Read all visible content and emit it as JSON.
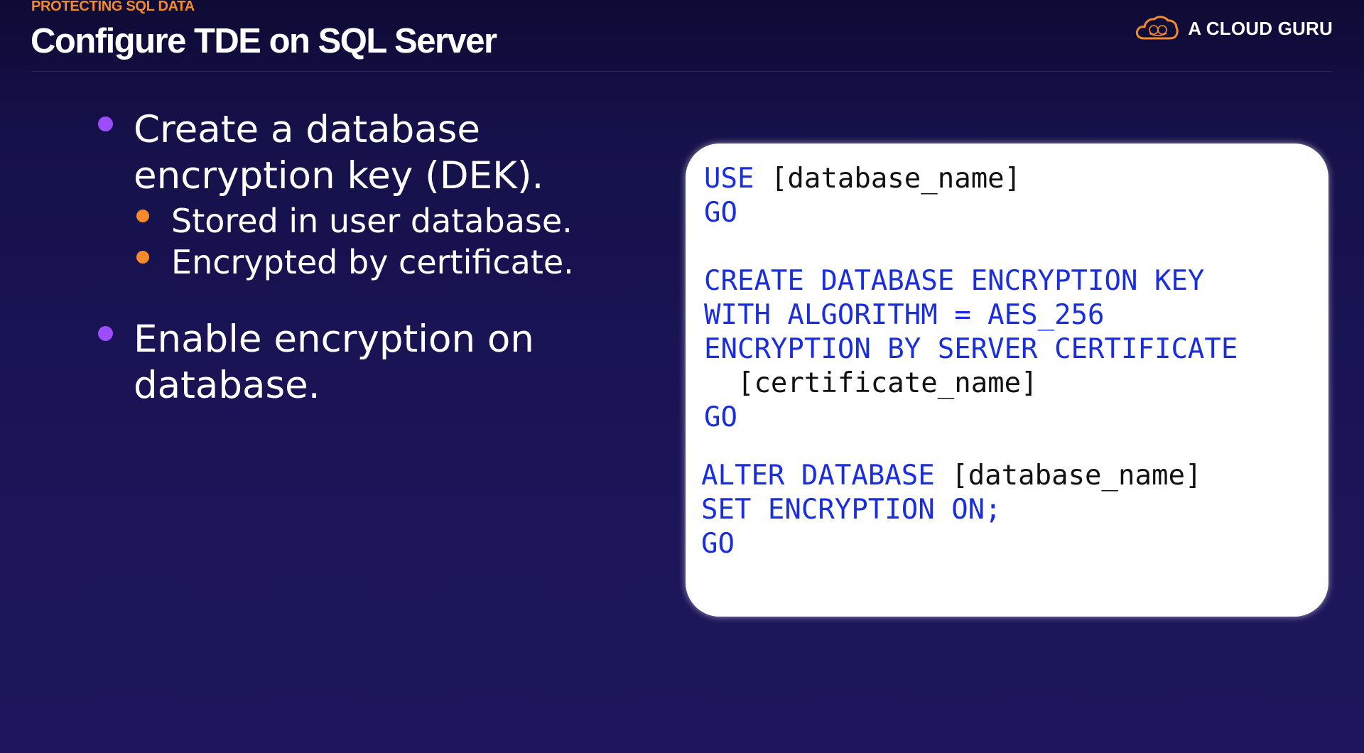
{
  "header": {
    "topic": "PROTECTING SQL DATA",
    "title": "Configure TDE on SQL Server"
  },
  "brand": {
    "name": "A CLOUD GURU",
    "logo_icon": "cloud-logo-icon",
    "accent_color": "#f58a2b"
  },
  "colors": {
    "bullet_primary": "#9b4dff",
    "bullet_secondary": "#f58a2b",
    "keyword": "#1a2ee0",
    "identifier": "#111111"
  },
  "bullets": [
    {
      "text": "Create a database encryption key (DEK).",
      "sub": [
        "Stored in user database.",
        "Encrypted by certificate."
      ]
    },
    {
      "text": "Enable encryption on database.",
      "sub": []
    }
  ],
  "code": {
    "use": {
      "kw1": "USE",
      "id1": "[database_name]",
      "go": "GO"
    },
    "create": {
      "line1": "CREATE DATABASE ENCRYPTION KEY",
      "line2": "WITH ALGORITHM = AES_256",
      "line3": "ENCRYPTION BY SERVER CERTIFICATE",
      "line4": "[certificate_name]",
      "go": "GO"
    },
    "alter": {
      "kw1": "ALTER DATABASE",
      "id1": "[database_name]",
      "line2": "SET ENCRYPTION ON;",
      "go": "GO"
    }
  }
}
